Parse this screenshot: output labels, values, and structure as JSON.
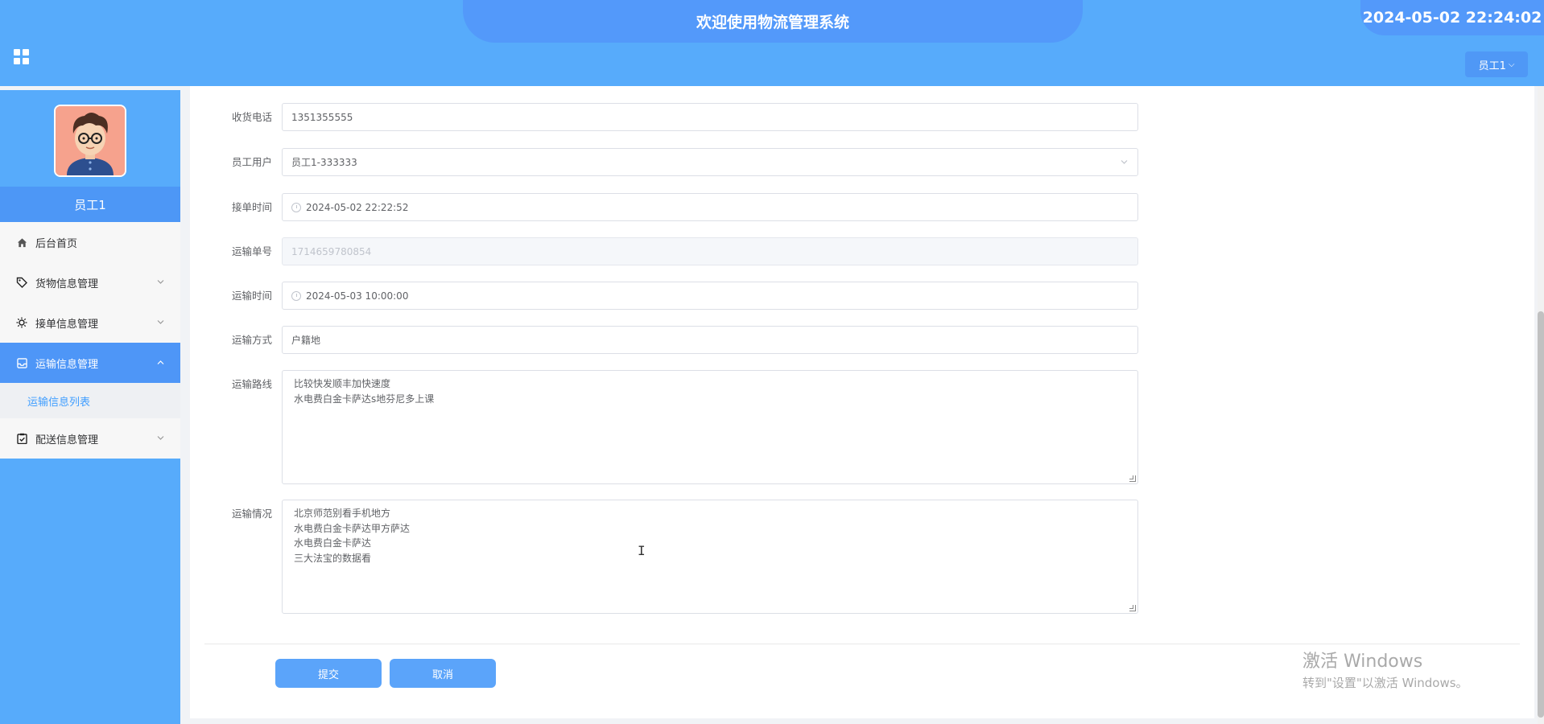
{
  "header": {
    "title": "欢迎使用物流管理系统",
    "datetime": "2024-05-02 22:24:02",
    "user_menu": "员工1",
    "user_menu_chevron": "⌵"
  },
  "sidebar": {
    "username": "员工1",
    "items": [
      {
        "label": "后台首页",
        "icon": "home-icon"
      },
      {
        "label": "货物信息管理",
        "icon": "tag-icon"
      },
      {
        "label": "接单信息管理",
        "icon": "sun-icon"
      },
      {
        "label": "运输信息管理",
        "icon": "inbox-icon"
      },
      {
        "label": "配送信息管理",
        "icon": "clipboard-check-icon"
      }
    ],
    "submenu": {
      "label": "运输信息列表"
    }
  },
  "form": {
    "phone": {
      "label": "收货电话",
      "value": "1351355555"
    },
    "employee": {
      "label": "员工用户",
      "value": "员工1-333333"
    },
    "order_time": {
      "label": "接单时间",
      "value": "2024-05-02 22:22:52"
    },
    "transport_no": {
      "label": "运输单号",
      "value": "1714659780854"
    },
    "transport_time": {
      "label": "运输时间",
      "value": "2024-05-03 10:00:00"
    },
    "transport_mode": {
      "label": "运输方式",
      "value": "户籍地"
    },
    "route": {
      "label": "运输路线",
      "lines": [
        "比较快发顺丰加快速度",
        "水电费白金卡萨达s地芬尼多上课"
      ]
    },
    "status": {
      "label": "运输情况",
      "lines": [
        "北京师范别看手机地方",
        "水电费白金卡萨达甲方萨达",
        "水电费白金卡萨达",
        "三大法宝的数据看"
      ]
    }
  },
  "actions": {
    "submit": "提交",
    "cancel": "取消"
  },
  "watermark": {
    "line1": "激活 Windows",
    "line2": "转到\"设置\"以激活 Windows。"
  },
  "colors": {
    "header": "#57abfb",
    "accent": "#5399fa",
    "active": "#4e96f7",
    "button": "#5ba4fa"
  }
}
